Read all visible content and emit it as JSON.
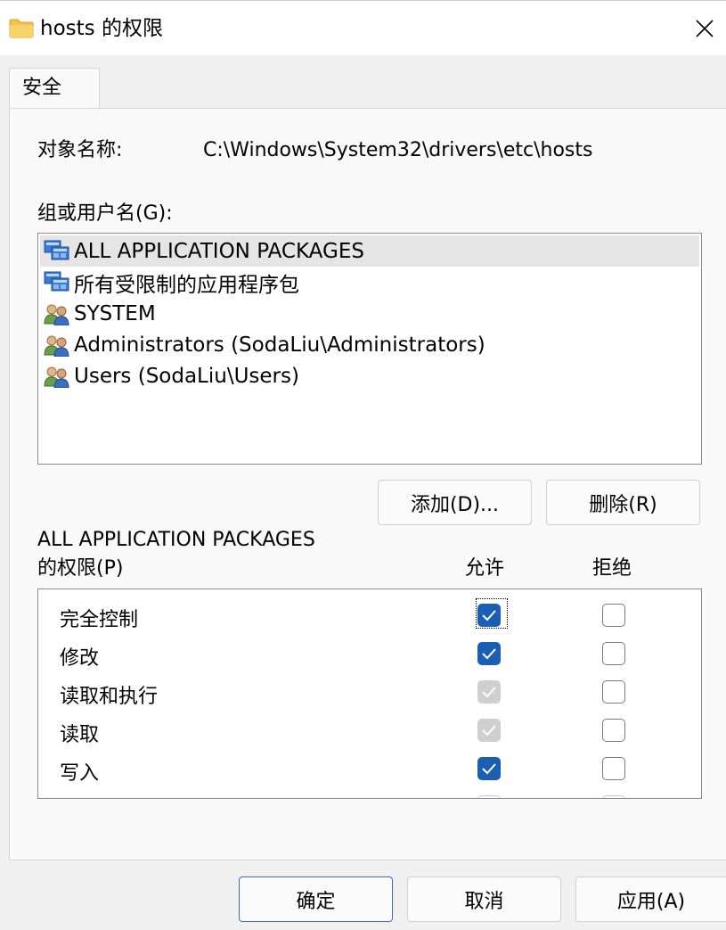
{
  "window": {
    "title": "hosts 的权限",
    "close_icon": "close-icon",
    "folder_icon": "folder-icon"
  },
  "tabs": [
    {
      "label": "安全"
    }
  ],
  "object": {
    "label": "对象名称:",
    "value": "C:\\Windows\\System32\\drivers\\etc\\hosts"
  },
  "groups": {
    "label": "组或用户名(G):",
    "items": [
      {
        "name": "ALL APPLICATION PACKAGES",
        "icon": "app-packages-icon",
        "selected": true
      },
      {
        "name": "所有受限制的应用程序包",
        "icon": "app-packages-icon",
        "selected": false
      },
      {
        "name": "SYSTEM",
        "icon": "users-icon",
        "selected": false
      },
      {
        "name": "Administrators (SodaLiu\\Administrators)",
        "icon": "users-icon",
        "selected": false
      },
      {
        "name": "Users (SodaLiu\\Users)",
        "icon": "users-icon",
        "selected": false
      }
    ],
    "add_button": "添加(D)...",
    "remove_button": "删除(R)"
  },
  "permissions": {
    "title_line1": "ALL APPLICATION PACKAGES",
    "title_line2": "的权限(P)",
    "allow_header": "允许",
    "deny_header": "拒绝",
    "rows": [
      {
        "name": "完全控制",
        "allow": "checked",
        "deny": "empty"
      },
      {
        "name": "修改",
        "allow": "checked",
        "deny": "empty"
      },
      {
        "name": "读取和执行",
        "allow": "disabled",
        "deny": "empty"
      },
      {
        "name": "读取",
        "allow": "disabled",
        "deny": "empty"
      },
      {
        "name": "写入",
        "allow": "checked",
        "deny": "empty"
      }
    ]
  },
  "footer": {
    "ok": "确定",
    "cancel": "取消",
    "apply": "应用(A)"
  },
  "colors": {
    "accent": "#1a5fb4",
    "disabled_check": "#cfcfcf",
    "selected_row": "#e5e5e5"
  }
}
